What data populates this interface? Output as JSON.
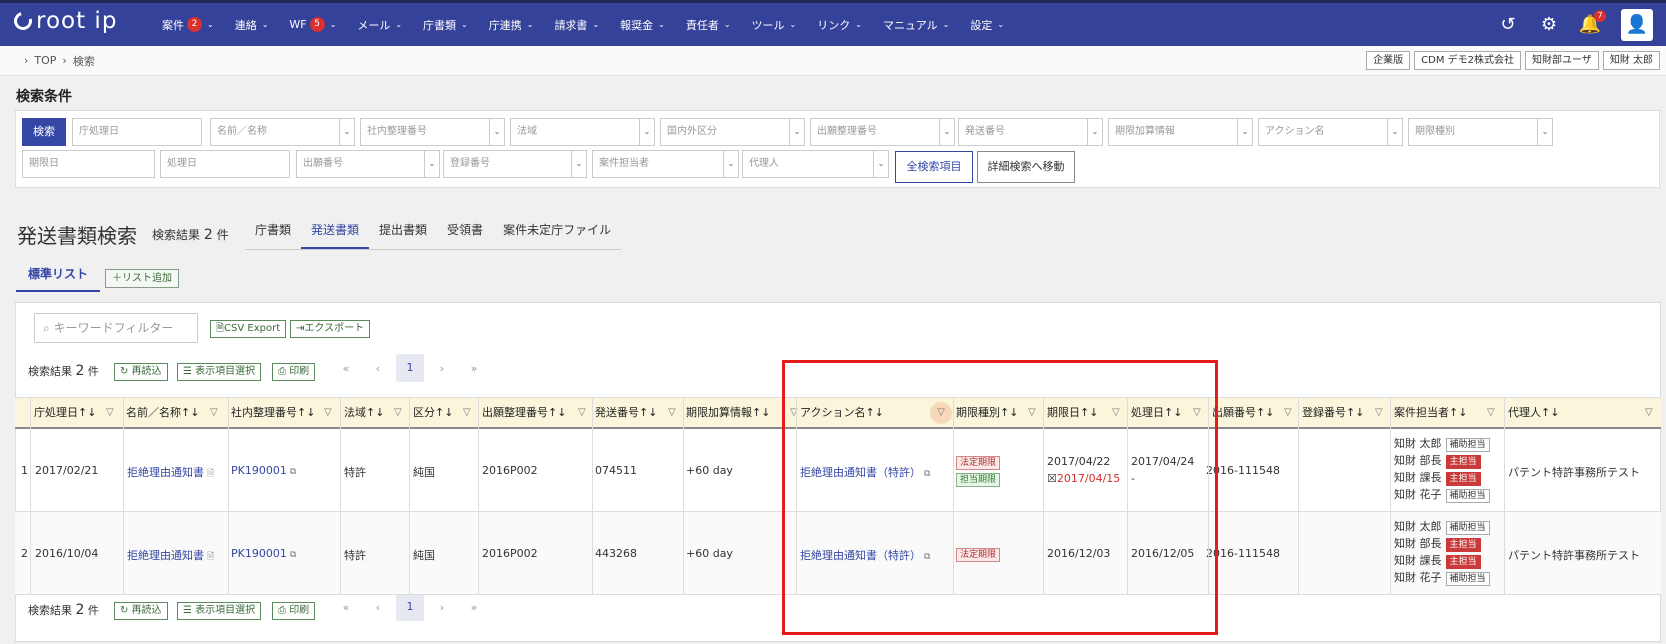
{
  "nav": {
    "logo": "root ip",
    "menu": [
      {
        "label": "案件",
        "badge": "2"
      },
      {
        "label": "連絡",
        "badge": ""
      },
      {
        "label": "WF",
        "badge": "5"
      },
      {
        "label": "メール",
        "badge": ""
      },
      {
        "label": "庁書類",
        "badge": ""
      },
      {
        "label": "庁連携",
        "badge": ""
      },
      {
        "label": "請求書",
        "badge": ""
      },
      {
        "label": "報奨金",
        "badge": ""
      },
      {
        "label": "責任者",
        "badge": ""
      },
      {
        "label": "ツール",
        "badge": ""
      },
      {
        "label": "リンク",
        "badge": ""
      },
      {
        "label": "マニュアル",
        "badge": ""
      },
      {
        "label": "設定",
        "badge": ""
      }
    ],
    "notifications": "7"
  },
  "breadcrumb": {
    "home": "TOP",
    "current": "検索",
    "sep": "›"
  },
  "header_chips": [
    "企業版",
    "CDM デモ2株式会社",
    "知財部ユーザ",
    "知財 太郎"
  ],
  "search": {
    "title": "検索条件",
    "search_button": "検索",
    "row1": [
      "庁処理日",
      "名前／名称",
      "社内整理番号",
      "法域",
      "国内外区分",
      "出願整理番号",
      "発送番号",
      "期限加算情報",
      "アクション名",
      "期限種別"
    ],
    "row2": [
      "期限日",
      "処理日",
      "出願番号",
      "登録番号",
      "案件担当者",
      "代理人"
    ],
    "all_fields_button": "全検索項目",
    "advanced_button": "詳細検索へ移動"
  },
  "page": {
    "title": "発送書類検索",
    "result_label": "検索結果",
    "result_count": "2",
    "result_unit": "件",
    "tabs": [
      "庁書類",
      "発送書類",
      "提出書類",
      "受領書",
      "案件未定庁ファイル"
    ],
    "active_tab": "発送書類"
  },
  "list": {
    "tab": "標準リスト",
    "add": "＋リスト追加",
    "keyword_placeholder": "キーワードフィルター",
    "csv": "CSV Export",
    "export": "エクスポート",
    "reload": "再読込",
    "columns_select": "表示項目選択",
    "print": "印刷",
    "page": "1"
  },
  "table": {
    "headers": [
      "庁処理日",
      "名前／名称",
      "社内整理番号",
      "法域",
      "区分",
      "出願整理番号",
      "発送番号",
      "期限加算情報",
      "アクション名",
      "期限種別",
      "期限日",
      "処理日",
      "出願番号",
      "登録番号",
      "案件担当者",
      "代理人"
    ],
    "rows": [
      {
        "no": "1",
        "date": "2017/02/21",
        "name": "拒絶理由通知書",
        "internal": "PK190001",
        "law": "特許",
        "kubun": "純国",
        "app_ref": "2016P002",
        "send_no": "074511",
        "extra": "+60 day",
        "action": "拒絶理由通知書（特許）",
        "types": [
          {
            "label": "法定期限",
            "kind": "rd"
          },
          {
            "label": "担当期限",
            "kind": "gn"
          }
        ],
        "deadline": "2017/04/22",
        "deadline2": "2017/04/15",
        "processed": "2017/04/24",
        "processed2": "-",
        "app_no": "2016-111548",
        "reg_no": "",
        "staff": [
          {
            "name": "知財 太郎",
            "role": "補助担当",
            "kind": "gy"
          },
          {
            "name": "知財 部長",
            "role": "主担当",
            "kind": "rf"
          },
          {
            "name": "知財 課長",
            "role": "主担当",
            "kind": "rf"
          },
          {
            "name": "知財 花子",
            "role": "補助担当",
            "kind": "gy"
          }
        ],
        "agent": "パテント特許事務所テスト"
      },
      {
        "no": "2",
        "date": "2016/10/04",
        "name": "拒絶理由通知書",
        "internal": "PK190001",
        "law": "特許",
        "kubun": "純国",
        "app_ref": "2016P002",
        "send_no": "443268",
        "extra": "+60 day",
        "action": "拒絶理由通知書（特許）",
        "types": [
          {
            "label": "法定期限",
            "kind": "rd"
          }
        ],
        "deadline": "2016/12/03",
        "deadline2": "",
        "processed": "2016/12/05",
        "processed2": "",
        "app_no": "2016-111548",
        "reg_no": "",
        "staff": [
          {
            "name": "知財 太郎",
            "role": "補助担当",
            "kind": "gy"
          },
          {
            "name": "知財 部長",
            "role": "主担当",
            "kind": "rf"
          },
          {
            "name": "知財 課長",
            "role": "主担当",
            "kind": "rf"
          },
          {
            "name": "知財 花子",
            "role": "補助担当",
            "kind": "gy"
          }
        ],
        "agent": "パテント特許事務所テスト"
      }
    ]
  }
}
